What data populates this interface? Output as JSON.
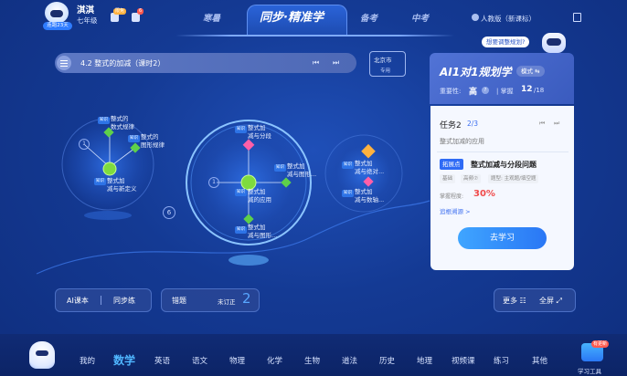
{
  "user": {
    "name": "淇淇",
    "grade": "七年级",
    "streak": "连跑23天"
  },
  "topbar": {
    "badge_1": "限免",
    "badge_2": "6"
  },
  "tabs": [
    {
      "label": "寒暑"
    },
    {
      "label": "同步·精准学"
    },
    {
      "label": "备考"
    },
    {
      "label": "中考"
    }
  ],
  "edition": "人教版（新课标）",
  "lesson": {
    "title": "4.2 整式的加减（课时2）",
    "prev": "▶◀",
    "next": "▶▶"
  },
  "region": {
    "city": "北京市",
    "tag": "专用"
  },
  "ai_panel": {
    "tip": "想要调整规划?",
    "title": "AI1对1规划学",
    "mode": "模式 ⇆",
    "importance_label": "重要性:",
    "importance_value": "高",
    "mastery_label": "| 掌握",
    "mastery_value": "12",
    "mastery_total": "/18"
  },
  "task": {
    "label": "任务2",
    "count": "2/3",
    "subtitle": "整式加减的应用",
    "tag": "拓展点",
    "name": "整式加减与分段问题",
    "chips": [
      "基础",
      "高频⑦",
      "题型: 主观题/填空题"
    ],
    "mastery_label": "掌握程度:",
    "mastery_value": "30%",
    "trace": "追根溯源 >",
    "go_button": "去学习"
  },
  "map": {
    "nodes": [
      {
        "mini": "知识",
        "label": "整式的\n数式规律"
      },
      {
        "mini": "知识",
        "label": "整式的\n图形规律"
      },
      {
        "mini": "知识",
        "label": "整式加\n减与新定义"
      },
      {
        "mini": "知识",
        "label": "整式加\n减与分段"
      },
      {
        "mini": "知识",
        "label": "整式加\n减与图形..."
      },
      {
        "mini": "知识",
        "label": "整式加\n减的应用"
      },
      {
        "mini": "知识",
        "label": "整式加\n减与图形..."
      },
      {
        "mini": "知识",
        "label": "整式加\n减与绝对..."
      },
      {
        "mini": "知识",
        "label": "整式加\n减与数轴..."
      }
    ],
    "counters": [
      "1",
      "1",
      "6"
    ]
  },
  "bottom_buttons": {
    "textbook": "AI课本",
    "sync": "同步练",
    "wrong": "错题",
    "wrong_status": "未订正",
    "wrong_count": "2",
    "more": "更多 ☷",
    "fullscreen": "全屏 ⤢"
  },
  "subjects": [
    "我的",
    "数学",
    "英语",
    "语文",
    "物理",
    "化学",
    "生物",
    "道法",
    "历史",
    "地理",
    "视频课",
    "练习",
    "其他"
  ],
  "tools": {
    "label": "学习工具",
    "new": "有更新"
  }
}
